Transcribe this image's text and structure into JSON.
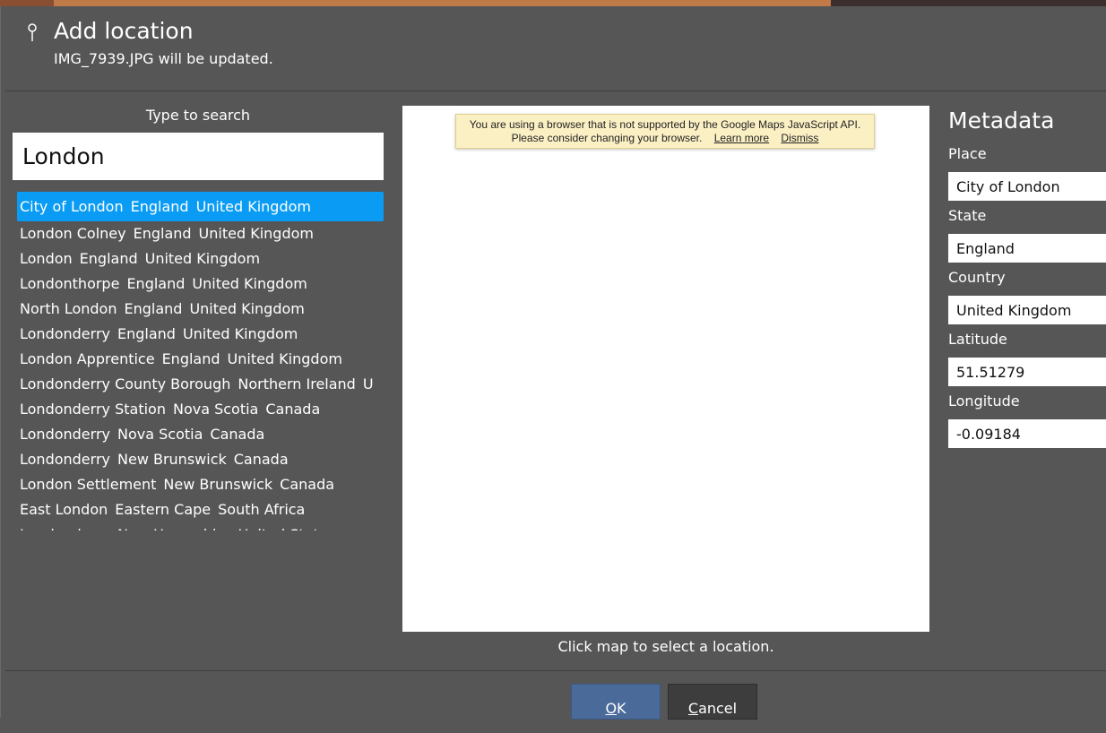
{
  "dialog": {
    "title": "Add location",
    "subtitle": "IMG_7939.JPG will be updated."
  },
  "search": {
    "label": "Type to search",
    "value": "London",
    "results": [
      {
        "place": "City of London",
        "state": "England",
        "country": "United Kingdom",
        "selected": true
      },
      {
        "place": "London Colney",
        "state": "England",
        "country": "United Kingdom"
      },
      {
        "place": "London",
        "state": "England",
        "country": "United Kingdom"
      },
      {
        "place": "Londonthorpe",
        "state": "England",
        "country": "United Kingdom"
      },
      {
        "place": "North London",
        "state": "England",
        "country": "United Kingdom"
      },
      {
        "place": "Londonderry",
        "state": "England",
        "country": "United Kingdom"
      },
      {
        "place": "London Apprentice",
        "state": "England",
        "country": "United Kingdom"
      },
      {
        "place": "Londonderry County Borough",
        "state": "Northern Ireland",
        "country": "U"
      },
      {
        "place": "Londonderry Station",
        "state": "Nova Scotia",
        "country": "Canada"
      },
      {
        "place": "Londonderry",
        "state": "Nova Scotia",
        "country": "Canada"
      },
      {
        "place": "Londonderry",
        "state": "New Brunswick",
        "country": "Canada"
      },
      {
        "place": "London Settlement",
        "state": "New Brunswick",
        "country": "Canada"
      },
      {
        "place": "East London",
        "state": "Eastern Cape",
        "country": "South Africa"
      },
      {
        "place": "Londonderry",
        "state": "New Hampshire",
        "country": "United States"
      }
    ]
  },
  "map": {
    "warning_line1": "You are using a browser that is not supported by the Google Maps JavaScript API.",
    "warning_line2": "Please consider changing your browser.",
    "learn_more": "Learn more",
    "dismiss": "Dismiss",
    "hint": "Click map to select a location."
  },
  "metadata": {
    "title": "Metadata",
    "place_label": "Place",
    "place_value": "City of London",
    "state_label": "State",
    "state_value": "England",
    "country_label": "Country",
    "country_value": "United Kingdom",
    "latitude_label": "Latitude",
    "latitude_value": "51.51279",
    "longitude_label": "Longitude",
    "longitude_value": "-0.09184"
  },
  "buttons": {
    "ok_mnemonic": "O",
    "ok_rest": "K",
    "cancel_mnemonic": "C",
    "cancel_rest": "ancel"
  },
  "icons": {
    "pin": "map-pin-icon"
  },
  "colors": {
    "selection": "#0a9cf5",
    "ok_button": "#4a6a99",
    "dialog_bg": "#565656"
  }
}
